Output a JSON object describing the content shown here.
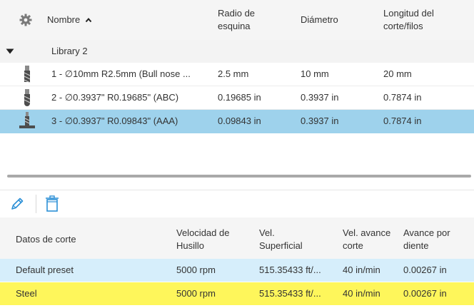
{
  "tool_table": {
    "columns": {
      "name": "Nombre",
      "corner_radius": "Radio de esquina",
      "diameter": "Diámetro",
      "cut_length": "Longitud del corte/filos"
    },
    "group": {
      "label": "Library 2"
    },
    "rows": [
      {
        "name": "1 - ∅10mm R2.5mm (Bull nose ...",
        "corner_radius": "2.5 mm",
        "diameter": "10 mm",
        "cut_length": "20 mm"
      },
      {
        "name": "2 - ∅0.3937\" R0.19685\" (ABC)",
        "corner_radius": "0.19685 in",
        "diameter": "0.3937 in",
        "cut_length": "0.7874 in"
      },
      {
        "name": "3 - ∅0.3937\" R0.09843\" (AAA)",
        "corner_radius": "0.09843 in",
        "diameter": "0.3937 in",
        "cut_length": "0.7874 in"
      }
    ]
  },
  "cutting_table": {
    "columns": {
      "data": "Datos de corte",
      "spindle": "Velocidad de Husillo",
      "surface": "Vel. Superficial",
      "feed": "Vel. avance corte",
      "per_tooth": "Avance por diente"
    },
    "rows": [
      {
        "data": "Default preset",
        "spindle": "5000 rpm",
        "surface": "515.35433 ft/...",
        "feed": "40 in/min",
        "per_tooth": "0.00267 in"
      },
      {
        "data": "Steel",
        "spindle": "5000 rpm",
        "surface": "515.35433 ft/...",
        "feed": "40 in/min",
        "per_tooth": "0.00267 in"
      }
    ]
  },
  "colors": {
    "selected_row": "#9ed2ec",
    "preset_row": "#d6eefb",
    "highlight_row": "#fef65b",
    "accent_icon": "#2b8fd6"
  },
  "icons": {
    "settings": "gear-icon",
    "sort": "chevron-up-icon",
    "group_toggle": "caret-down-icon",
    "tool_1": "bull-nose-mill-icon",
    "tool_2": "ball-mill-icon",
    "tool_3": "tool-icon",
    "edit": "pencil-icon",
    "delete": "trash-icon"
  }
}
